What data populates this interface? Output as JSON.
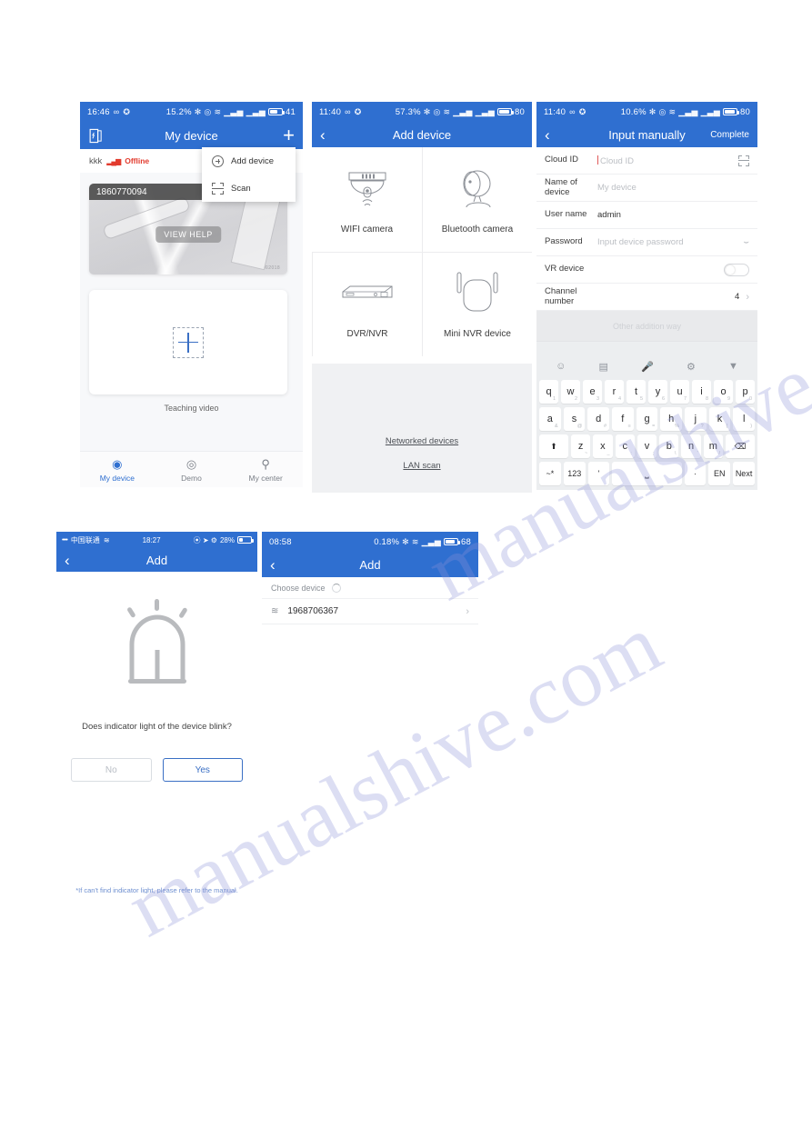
{
  "watermark": {
    "line1": "manualshive.com",
    "line2": "manualshive.com"
  },
  "panel1": {
    "status": {
      "time": "16:46",
      "infinity": "∞",
      "sync": "✪",
      "percent": "15.2%",
      "bluetooth": "✻",
      "alarm": "◎",
      "wifi": "≋",
      "sim1": "▁▃▅",
      "sim2": "▁▃▅",
      "battery": "41"
    },
    "nav": {
      "title": "My device",
      "left_icon": "exit-door-icon",
      "right_icon": "plus-icon"
    },
    "device_row": {
      "name": "kkk",
      "signal": "▂▄▆",
      "status": "Offline"
    },
    "popup": {
      "items": [
        {
          "label": "Add device",
          "icon": "circle-plus-icon"
        },
        {
          "label": "Scan",
          "icon": "scan-frame-icon"
        }
      ]
    },
    "thumbnail": {
      "id": "1860770094",
      "overlay_button": "VIEW HELP",
      "brand": "©2018"
    },
    "add_card": {
      "icon": "plus-icon"
    },
    "teaching": "Teaching video",
    "tabs": [
      {
        "label": "My device",
        "icon": "camera-icon",
        "glyph": "◉",
        "active": true
      },
      {
        "label": "Demo",
        "icon": "circle-target-icon",
        "glyph": "◎",
        "active": false
      },
      {
        "label": "My center",
        "icon": "person-icon",
        "glyph": "⚲",
        "active": false
      }
    ]
  },
  "panel2": {
    "status": {
      "time": "11:40",
      "infinity": "∞",
      "sync": "✪",
      "percent": "57.3%",
      "bluetooth": "✻",
      "alarm": "◎",
      "wifi": "≋",
      "sim1": "▁▃▅",
      "sim2": "▁▃▅",
      "battery": "80"
    },
    "nav": {
      "title": "Add device",
      "back": "‹"
    },
    "grid": [
      {
        "label": "WIFI camera",
        "icon": "dome-wifi-camera-icon"
      },
      {
        "label": "Bluetooth camera",
        "icon": "bluetooth-camera-icon"
      },
      {
        "label": "DVR/NVR",
        "icon": "dvr-nvr-icon"
      },
      {
        "label": "Mini NVR device",
        "icon": "mini-nvr-antenna-icon"
      }
    ],
    "links": [
      "Networked devices",
      "LAN scan"
    ]
  },
  "panel3": {
    "status": {
      "time": "11:40",
      "infinity": "∞",
      "sync": "✪",
      "percent": "10.6%",
      "bluetooth": "✻",
      "alarm": "◎",
      "wifi": "≋",
      "sim1": "▁▃▅",
      "sim2": "▁▃▅",
      "battery": "80"
    },
    "nav": {
      "title": "Input manually",
      "back": "‹",
      "complete": "Complete"
    },
    "fields": [
      {
        "label": "Cloud ID",
        "value": "",
        "placeholder": "Cloud ID",
        "trailing": "scan-frame-icon"
      },
      {
        "label": "Name of device",
        "value": "",
        "placeholder": "My device",
        "trailing": ""
      },
      {
        "label": "User name",
        "value": "admin",
        "placeholder": "",
        "trailing": ""
      },
      {
        "label": "Password",
        "value": "",
        "placeholder": "Input device password",
        "trailing": "eye-icon"
      },
      {
        "label": "VR device",
        "value": "",
        "placeholder": "",
        "trailing": "toggle-off"
      },
      {
        "label": "Channel number",
        "value": "4",
        "placeholder": "",
        "trailing": "chevron-right-icon"
      }
    ],
    "other_row": "Other addition way",
    "keyboard": {
      "toolbar": [
        "emoji-icon",
        "keyboard-icon",
        "mic-icon",
        "settings-gear-icon",
        "chevron-down-icon"
      ],
      "row1": [
        {
          "k": "q",
          "s": "1"
        },
        {
          "k": "w",
          "s": "2"
        },
        {
          "k": "e",
          "s": "3"
        },
        {
          "k": "r",
          "s": "4"
        },
        {
          "k": "t",
          "s": "5"
        },
        {
          "k": "y",
          "s": "6"
        },
        {
          "k": "u",
          "s": "7"
        },
        {
          "k": "i",
          "s": "8"
        },
        {
          "k": "o",
          "s": "9"
        },
        {
          "k": "p",
          "s": "0"
        }
      ],
      "row2": [
        {
          "k": "a",
          "s": "&"
        },
        {
          "k": "s",
          "s": "@"
        },
        {
          "k": "d",
          "s": "#"
        },
        {
          "k": "f",
          "s": "≡"
        },
        {
          "k": "g",
          "s": "="
        },
        {
          "k": "h",
          "s": "%"
        },
        {
          "k": "j",
          "s": "?"
        },
        {
          "k": "k",
          "s": "("
        },
        {
          "k": "l",
          "s": ")"
        }
      ],
      "row3": [
        {
          "k": "⬆",
          "s": ""
        },
        {
          "k": "z",
          "s": "~"
        },
        {
          "k": "x",
          "s": "_"
        },
        {
          "k": "c",
          "s": ":"
        },
        {
          "k": "v",
          "s": ";"
        },
        {
          "k": "b",
          "s": "\\"
        },
        {
          "k": "n",
          "s": "'"
        },
        {
          "k": "m",
          "s": "/"
        },
        {
          "k": "⌫",
          "s": ""
        }
      ],
      "row4": [
        "~*",
        "123",
        "'",
        "⎵",
        "·",
        "EN",
        "Next"
      ]
    }
  },
  "panel4": {
    "status": {
      "dots": "••••",
      "carrier": "中国联通",
      "wifi": "≋",
      "time": "18:27",
      "icons": "⦿ ➤ ⚙",
      "battery_pct": "28%"
    },
    "nav": {
      "title": "Add",
      "back": "‹"
    },
    "illustration": "blinking-indicator-lamp-icon",
    "question": "Does indicator light of the device blink?",
    "buttons": [
      {
        "label": "No",
        "style": "secondary"
      },
      {
        "label": "Yes",
        "style": "primary"
      }
    ],
    "note": "*If can't find indicator light, please refer to the manual."
  },
  "panel5": {
    "status": {
      "time": "08:58",
      "percent": "0.18%",
      "bluetooth": "✻",
      "wifi": "≋",
      "sim": "▁▃▅",
      "battery": "68"
    },
    "nav": {
      "title": "Add",
      "back": "‹"
    },
    "choose_label": "Choose device",
    "devices": [
      {
        "id": "1968706367",
        "icon": "wifi-icon",
        "chevron": "›"
      }
    ]
  }
}
